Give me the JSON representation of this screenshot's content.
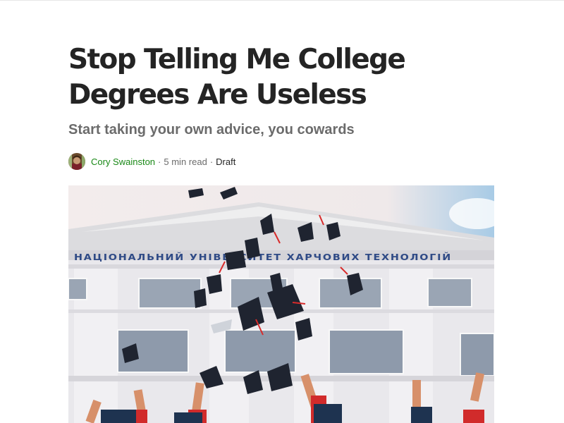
{
  "article": {
    "title": "Stop Telling Me College Degrees Are Useless",
    "subtitle": "Start taking your own advice, you cowards",
    "author": "Cory Swainston",
    "separator": "·",
    "read_time": "5 min read",
    "status": "Draft"
  },
  "hero_image": {
    "building_sign": "НАЦІОНАЛЬНИЙ УНІВЕРСИТЕТ ХАРЧОВИХ ТЕХНОЛОГІЙ"
  },
  "colors": {
    "author_link": "#1a8917",
    "title": "#242424",
    "meta": "#6b6b6b"
  }
}
